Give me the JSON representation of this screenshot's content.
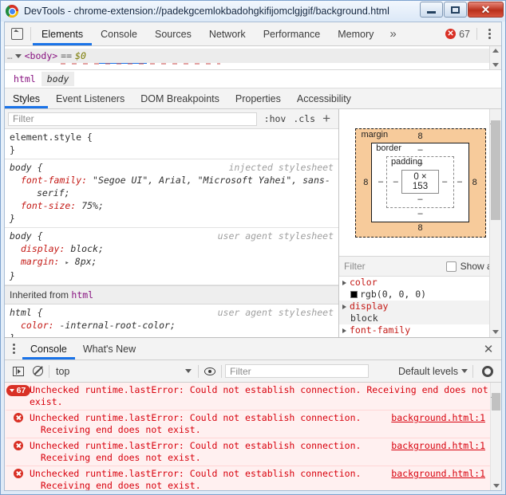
{
  "window": {
    "title": "DevTools - chrome-extension://padekgcemlokbadohgkifijomclgjgif/background.html",
    "minimize_label": "Minimize",
    "maximize_label": "Maximize",
    "close_label": "✕"
  },
  "main_toolbar": {
    "inspect_icon": "inspect-cursor-icon",
    "tabs": [
      {
        "label": "Elements",
        "active": true
      },
      {
        "label": "Console",
        "active": false
      },
      {
        "label": "Sources",
        "active": false
      },
      {
        "label": "Network",
        "active": false
      },
      {
        "label": "Performance",
        "active": false
      },
      {
        "label": "Memory",
        "active": false
      }
    ],
    "more_tabs": "»",
    "error_count": "67",
    "error_badge_glyph": "✕",
    "menu_icon": "kebab-menu-icon"
  },
  "dom_tree": {
    "node_line": "<body>",
    "node_tag_open": "<body>",
    "node_equals": "==",
    "node_ref": "$0",
    "expander": "▼",
    "ellipsis": "…"
  },
  "breadcrumb": {
    "items": [
      {
        "label": "html",
        "selected": false
      },
      {
        "label": "body",
        "selected": true
      }
    ]
  },
  "pane_tabs": [
    {
      "label": "Styles",
      "active": true
    },
    {
      "label": "Event Listeners",
      "active": false
    },
    {
      "label": "DOM Breakpoints",
      "active": false
    },
    {
      "label": "Properties",
      "active": false
    },
    {
      "label": "Accessibility",
      "active": false
    }
  ],
  "styles": {
    "filter_placeholder": "Filter",
    "hov_label": ":hov",
    "cls_label": ".cls",
    "new_rule_label": "+",
    "rules": [
      {
        "selector": "element.style {",
        "origin": "",
        "close": "}",
        "declarations": []
      },
      {
        "selector": "body {",
        "origin": "injected stylesheet",
        "close": "}",
        "declarations": [
          {
            "prop": "font-family:",
            "value": "\"Segoe UI\", Arial, \"Microsoft Yahei\", sans-",
            "cont": "serif;"
          },
          {
            "prop": "font-size:",
            "value": "75%;",
            "cont": ""
          }
        ]
      },
      {
        "selector": "body {",
        "origin": "user agent stylesheet",
        "close": "}",
        "declarations": [
          {
            "prop": "display:",
            "value": "block;",
            "cont": ""
          },
          {
            "prop": "margin:",
            "value": "8px;",
            "cont": "",
            "expandable": true
          }
        ]
      }
    ],
    "inherited_label": "Inherited from",
    "inherited_from": "html",
    "inherited_rules": [
      {
        "selector": "html {",
        "origin": "user agent stylesheet",
        "close": "}",
        "declarations": [
          {
            "prop": "color:",
            "value": "-internal-root-color;",
            "cont": ""
          }
        ]
      }
    ]
  },
  "box_model": {
    "margin_label": "margin",
    "border_label": "border",
    "padding_label": "padding",
    "content_size": "0 × 153",
    "margin_top": "8",
    "margin_right": "8",
    "margin_bottom": "8",
    "margin_left": "8",
    "border_top": "–",
    "border_right": "–",
    "border_bottom": "–",
    "border_left": "–",
    "padding_top": "–",
    "padding_right": "–",
    "padding_bottom": "–",
    "padding_left": "–",
    "margin_color": "#f7cb9b"
  },
  "computed": {
    "filter_placeholder": "Filter",
    "show_all_label": "Show all",
    "show_all_checked": false,
    "properties": [
      {
        "name": "color",
        "value": "rgb(0, 0, 0)",
        "swatch": "#000000"
      },
      {
        "name": "display",
        "value": "block",
        "swatch": ""
      },
      {
        "name": "font-family",
        "value": "",
        "swatch": ""
      }
    ]
  },
  "drawer": {
    "menu_icon": "kebab-menu-icon",
    "tabs": [
      {
        "label": "Console",
        "active": true
      },
      {
        "label": "What's New",
        "active": false
      }
    ],
    "close_label": "✕"
  },
  "console_toolbar": {
    "execute_icon": "execute-sidebar-icon",
    "clear_icon": "clear-console-icon",
    "context": "top",
    "context_caret": "▼",
    "eye_icon": "live-expression-icon",
    "filter_placeholder": "Filter",
    "levels_label": "Default levels",
    "levels_caret": "▼",
    "settings_icon": "gear-icon"
  },
  "console_messages": [
    {
      "kind": "group",
      "badge_count": "67",
      "badge_caret": "▼",
      "text": "Unchecked runtime.lastError: Could not establish connection. Receiving end does not exist.",
      "source": ""
    },
    {
      "kind": "error",
      "text": "Unchecked runtime.lastError: Could not establish connection.\n  Receiving end does not exist.",
      "source": "background.html:1"
    },
    {
      "kind": "error",
      "text": "Unchecked runtime.lastError: Could not establish connection.\n  Receiving end does not exist.",
      "source": "background.html:1"
    },
    {
      "kind": "error",
      "text": "Unchecked runtime.lastError: Could not establish connection.\n  Receiving end does not exist.",
      "source": "background.html:1"
    }
  ]
}
